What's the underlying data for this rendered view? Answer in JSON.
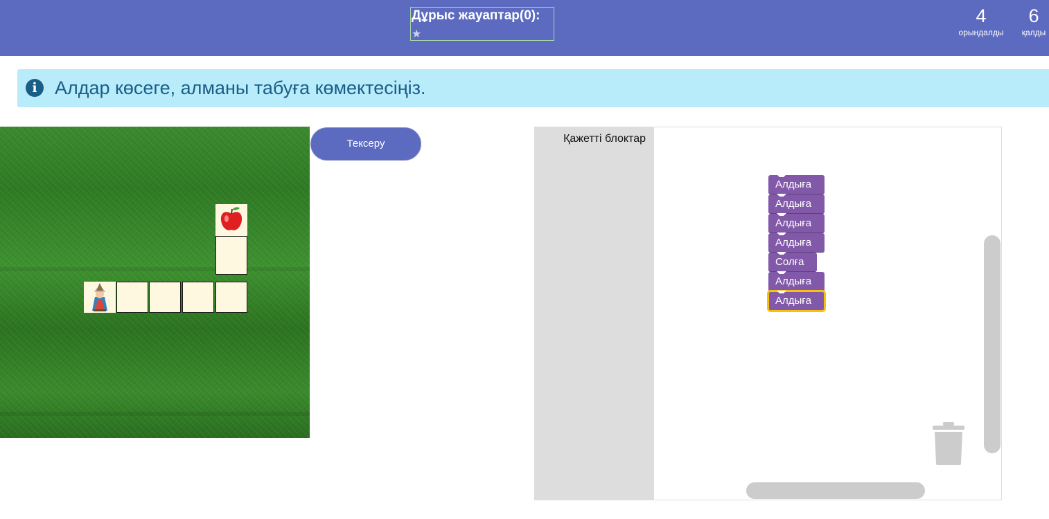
{
  "header": {
    "correct_answers_label": "Дұрыс жауаптар(0):",
    "star": "★",
    "done_count": "4",
    "done_label": "орындалды",
    "remaining_count": "6",
    "remaining_label": "қалды"
  },
  "info": {
    "icon": "info-icon",
    "text": "Алдар көсеге, алманы табуға көмектесіңіз."
  },
  "board": {
    "icons": [
      "aldar-kose-character-icon",
      "apple-icon"
    ]
  },
  "check_button": {
    "label": "Тексеру"
  },
  "workspace": {
    "toolbox_label": "Қажетті блоктар",
    "blocks": [
      "Алдыға",
      "Алдыға",
      "Алдыға",
      "Алдыға",
      "Солға",
      "Алдыға",
      "Алдыға"
    ],
    "selected_block_index": 6,
    "trash_icon": "trash-icon"
  },
  "colors": {
    "header": "#5c6bc0",
    "info_bg": "#b8ecfb",
    "info_text": "#1a5d87",
    "block": "#8159a8",
    "selected_outline": "#f9c10b",
    "tile": "#fef8e0"
  }
}
